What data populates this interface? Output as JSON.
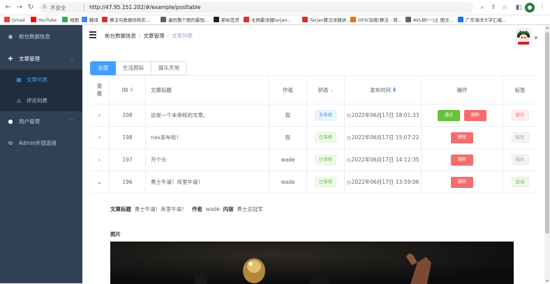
{
  "browser": {
    "insecure_label": "不安全",
    "url": "http://47.95.151.202/#/example/posttable",
    "bookmarks": [
      {
        "label": "Gmail",
        "color": "#ea4335"
      },
      {
        "label": "YouTube",
        "color": "#ff0000"
      },
      {
        "label": "地图",
        "color": "#34a853"
      },
      {
        "label": "翻译",
        "color": "#4285f4"
      },
      {
        "label": "算法与数据结构实...",
        "color": "#d93025"
      },
      {
        "label": "遍历整个图的最短...",
        "color": "#5f6368"
      },
      {
        "label": "新标签页",
        "color": "#202124"
      },
      {
        "label": "全网最详细tarjan...",
        "color": "#d93025"
      },
      {
        "label": "Tarjan算法详细讲...",
        "color": "#d93025"
      },
      {
        "label": "DFS(深搜)算法 - 简...",
        "color": "#e8710a"
      },
      {
        "label": "AVL树(一)之 图文...",
        "color": "#5f6368"
      },
      {
        "label": "广东海洋大学汇编...",
        "color": "#1a73e8"
      }
    ]
  },
  "sidebar": {
    "items": [
      {
        "label": "前台数据信息",
        "icon": "dashboard-icon"
      },
      {
        "label": "文章管理",
        "icon": "plus-circle-icon",
        "arrow": "︿"
      },
      {
        "label": "文章列表",
        "icon": "grid-icon",
        "active": true
      },
      {
        "label": "评论列表",
        "icon": "tree-icon"
      },
      {
        "label": "用户管理",
        "icon": "user-icon",
        "arrow": "﹀"
      },
      {
        "label": "Admin外部连接",
        "icon": "external-link-icon"
      }
    ]
  },
  "header": {
    "breadcrumb": [
      "前台数据信息",
      "文章管理",
      "文章列表"
    ]
  },
  "tabs": [
    {
      "label": "全部",
      "active": true
    },
    {
      "label": "生活周知",
      "active": false
    },
    {
      "label": "娱乐天地",
      "active": false
    }
  ],
  "table": {
    "columns": {
      "view": "查看",
      "id": "ID",
      "title": "文章标题",
      "author": "作者",
      "status": "状态",
      "time": "发布时间",
      "action": "操作",
      "tag": "标签"
    },
    "rows": [
      {
        "id": "208",
        "title": "这是一个未审核的文章。",
        "author": "叙",
        "status": "未审核",
        "status_type": "warn",
        "time": "2022年06月17日 18:01:33",
        "buttons": [
          "通过",
          "删除"
        ],
        "tag": "娱乐",
        "tag_type": "red",
        "expanded": false
      },
      {
        "id": "198",
        "title": "nav发布啦！",
        "author": "叙",
        "status": "已审核",
        "status_type": "ok",
        "time": "2022年06月17日 15:07:22",
        "buttons": [
          "删除"
        ],
        "tag": "玩乐",
        "tag_type": "gray",
        "expanded": false
      },
      {
        "id": "197",
        "title": "开个头",
        "author": "wade",
        "status": "已审核",
        "status_type": "ok",
        "time": "2022年06月17日 14:12:35",
        "buttons": [
          "删除"
        ],
        "tag": "玩乐",
        "tag_type": "gray",
        "expanded": false
      },
      {
        "id": "196",
        "title": "勇士牛逼！库里牛逼！",
        "author": "wade",
        "status": "已审核",
        "status_type": "ok",
        "time": "2022年06月17日 13:59:06",
        "buttons": [
          "删除"
        ],
        "tag": "运动",
        "tag_type": "green",
        "expanded": true
      }
    ]
  },
  "expanded_detail": {
    "title_label": "文章标题",
    "title_value": "勇士牛逼！库里牛逼！",
    "author_label": "作者",
    "author_value": "wade",
    "content_label": "内容",
    "content_value": "勇士总冠军",
    "photo_label": "照片"
  }
}
